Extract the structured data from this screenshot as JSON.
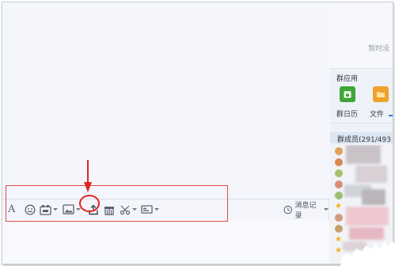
{
  "toolbar": {
    "font_tool": "A",
    "history_label": "消息记录"
  },
  "side_panel": {
    "notice_text": "暂时没",
    "apps_title": "群应用",
    "apps": [
      {
        "label": "群日历",
        "icon": "calendar-icon",
        "color": "#3fa63a"
      },
      {
        "label": "文件",
        "icon": "folder-icon",
        "color": "#f0a22a"
      }
    ],
    "members_title": "群成员(291/493"
  },
  "colors": {
    "annotation_red": "#e02424",
    "star": "#f2b01e"
  }
}
